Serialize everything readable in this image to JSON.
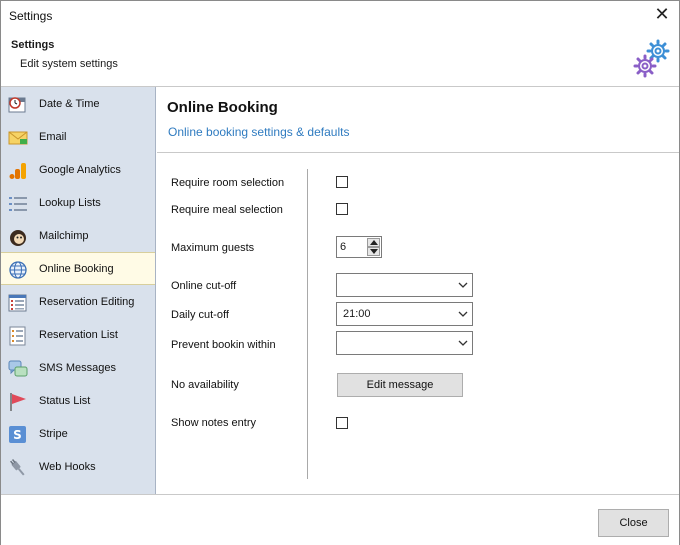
{
  "window": {
    "title": "Settings",
    "close_glyph": "✕"
  },
  "header": {
    "title": "Settings",
    "subtitle": "Edit system settings",
    "icon": "gears-icon"
  },
  "sidebar": {
    "items": [
      {
        "label": "Date & Time",
        "icon": "clock-calendar-icon"
      },
      {
        "label": "Email",
        "icon": "envelope-icon"
      },
      {
        "label": "Google Analytics",
        "icon": "bar-chart-icon"
      },
      {
        "label": "Lookup Lists",
        "icon": "list-icon"
      },
      {
        "label": "Mailchimp",
        "icon": "mailchimp-icon"
      },
      {
        "label": "Online Booking",
        "icon": "globe-icon",
        "active": true
      },
      {
        "label": "Reservation Editing",
        "icon": "form-edit-icon"
      },
      {
        "label": "Reservation List",
        "icon": "document-list-icon"
      },
      {
        "label": "SMS Messages",
        "icon": "chat-bubbles-icon"
      },
      {
        "label": "Status List",
        "icon": "flag-icon"
      },
      {
        "label": "Stripe",
        "icon": "stripe-icon"
      },
      {
        "label": "Web Hooks",
        "icon": "plug-icon"
      }
    ]
  },
  "content": {
    "title": "Online Booking",
    "subtitle": "Online booking settings & defaults",
    "fields": {
      "require_room": {
        "label": "Require room selection",
        "checked": false
      },
      "require_meal": {
        "label": "Require meal selection",
        "checked": false
      },
      "max_guests": {
        "label": "Maximum guests",
        "value": "6"
      },
      "online_cutoff": {
        "label": "Online cut-off",
        "value": ""
      },
      "daily_cutoff": {
        "label": "Daily cut-off",
        "value": "21:00"
      },
      "prevent_booking": {
        "label": "Prevent bookin within",
        "value": ""
      },
      "no_availability": {
        "label": "No availability",
        "button": "Edit message"
      },
      "show_notes": {
        "label": "Show notes entry",
        "checked": false
      }
    }
  },
  "footer": {
    "close_label": "Close"
  },
  "colors": {
    "sidebar_bg": "#d9e1ec",
    "active_bg": "#fffbe6",
    "accent": "#2f7bc0"
  }
}
